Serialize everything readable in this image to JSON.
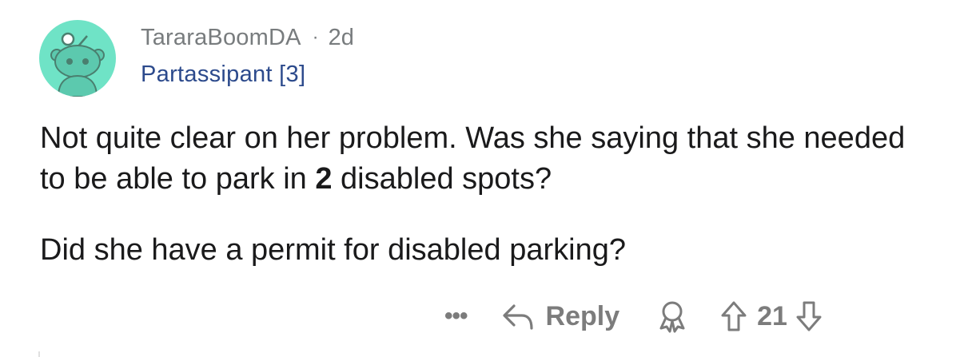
{
  "comment": {
    "username": "TararaBoomDA",
    "separator": "·",
    "age": "2d",
    "flair": "Partassipant [3]",
    "body": {
      "line1_before": "Not quite clear on her problem. Was she saying that she needed to be able to park in ",
      "line1_bold": "2",
      "line1_after": " disabled spots?",
      "paragraph2": "Did she have a permit for disabled parking?"
    },
    "actions": {
      "more_label": "•••",
      "reply_label": "Reply",
      "score": "21"
    }
  },
  "colors": {
    "avatar_bg": "#6fe3c6",
    "muted": "#7c7c7c",
    "flair": "#2c4a8c"
  },
  "icons": [
    "reddit-snoo-avatar-icon",
    "reply-arrow-icon",
    "award-icon",
    "upvote-arrow-icon",
    "downvote-arrow-icon"
  ]
}
